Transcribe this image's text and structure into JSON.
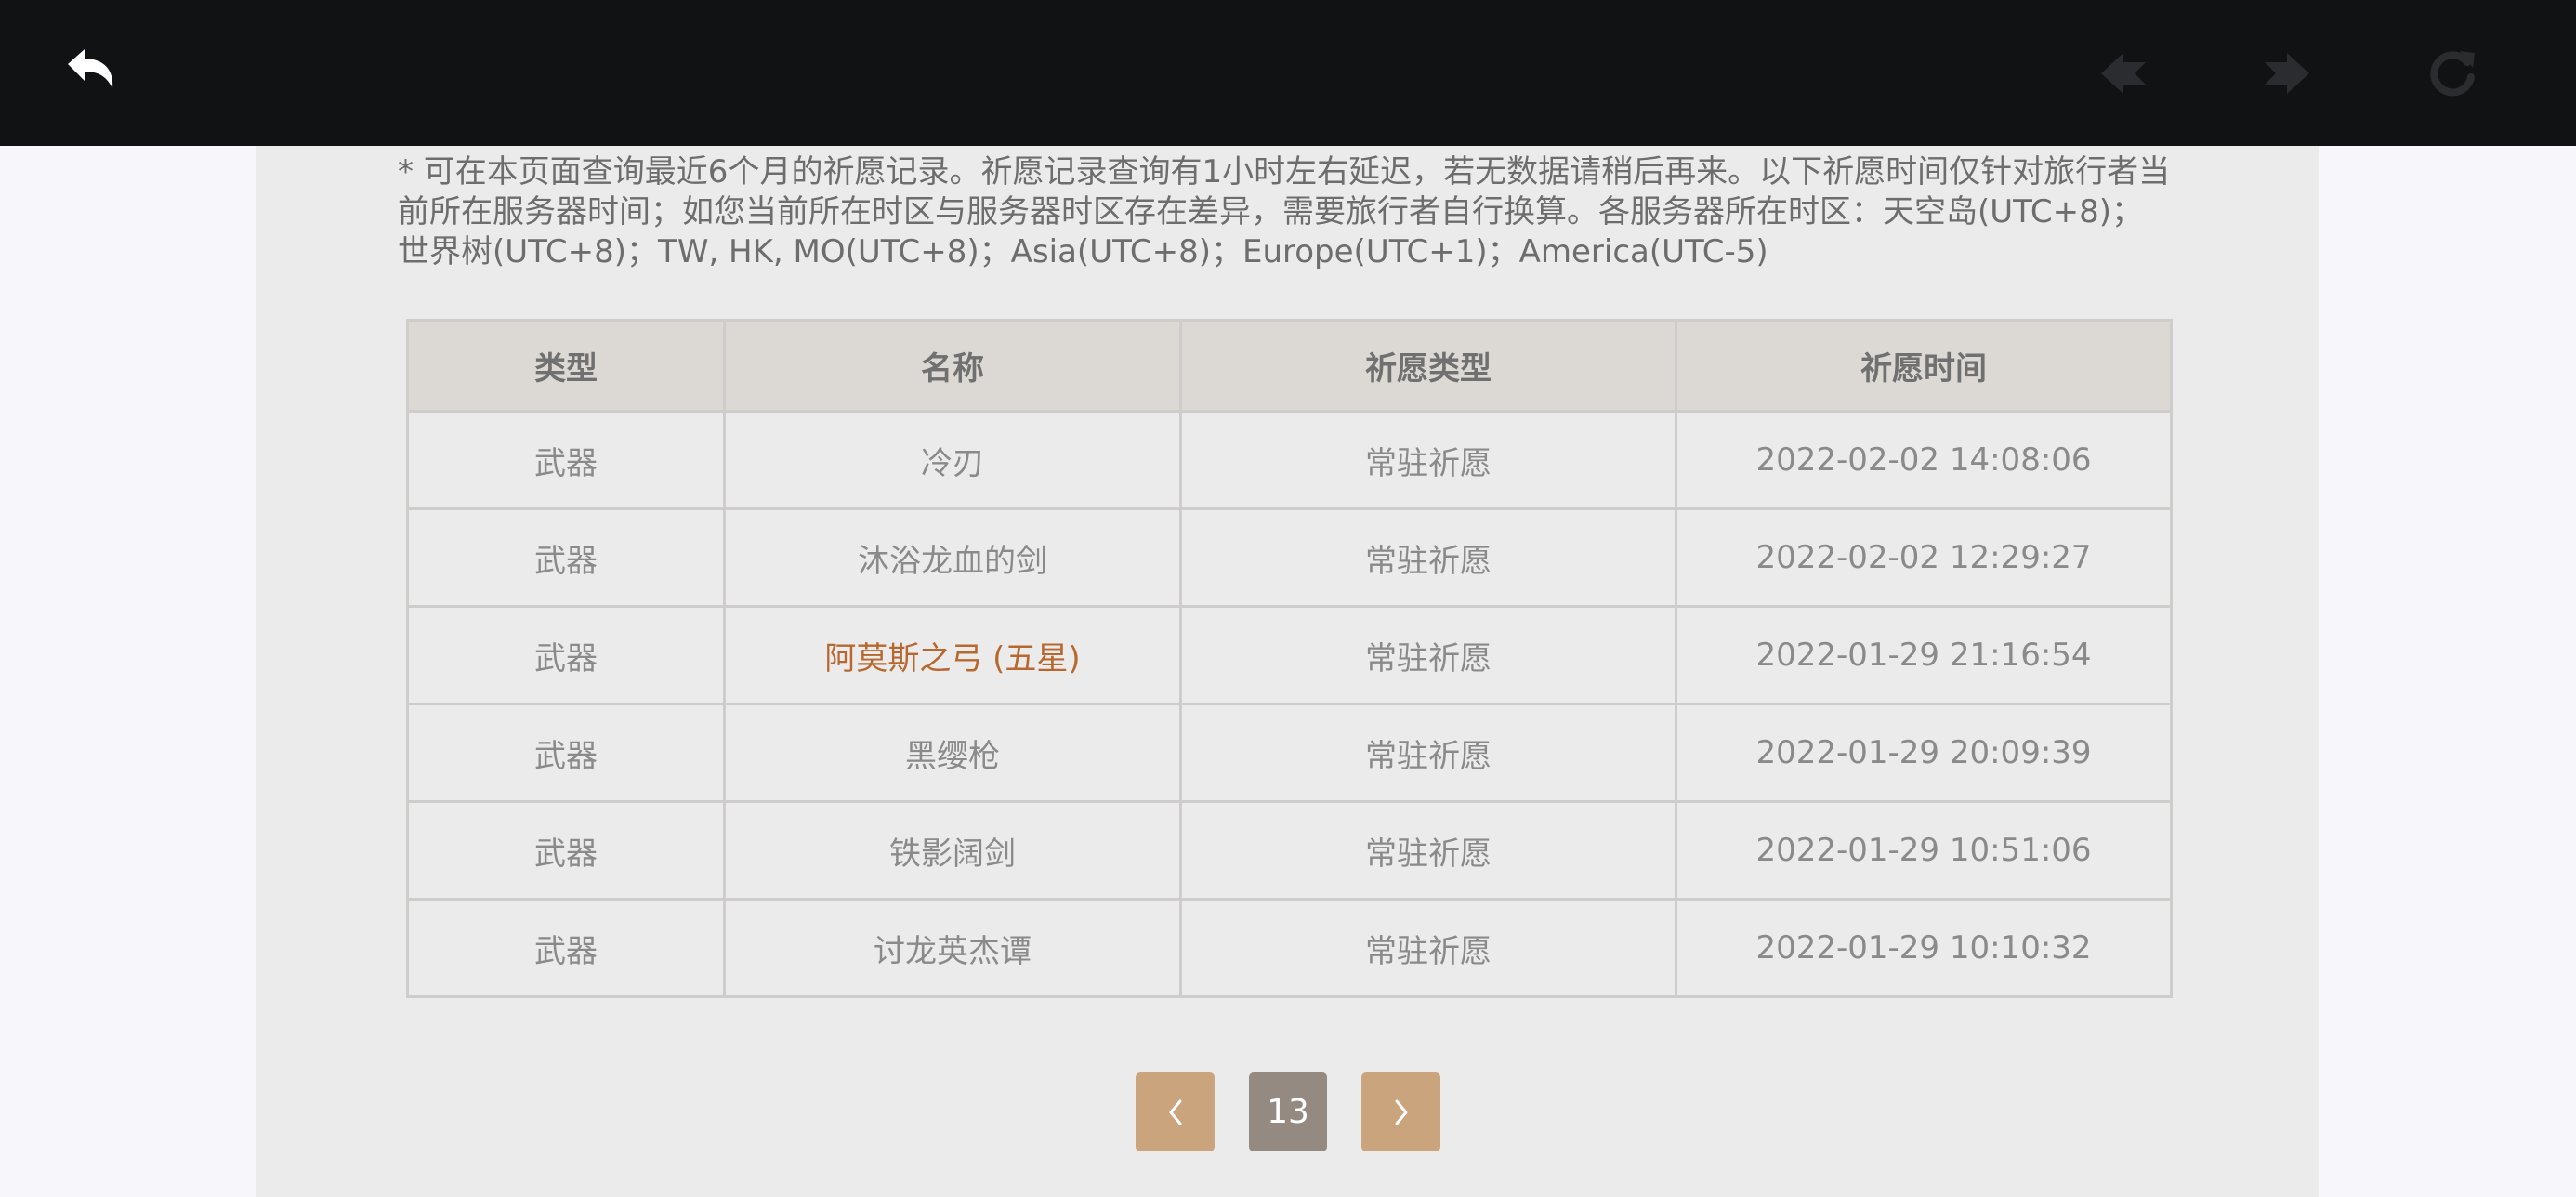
{
  "toolbar": {
    "back_icon": "back-arrow-icon",
    "prev_icon": "nav-prev-icon",
    "next_icon": "nav-next-icon",
    "reload_icon": "reload-icon"
  },
  "notice": {
    "text": "* 可在本页面查询最近6个月的祈愿记录。祈愿记录查询有1小时左右延迟，若无数据请稍后再来。以下祈愿时间仅针对旅行者当前所在服务器时间；如您当前所在时区与服务器时区存在差异，需要旅行者自行换算。各服务器所在时区：天空岛(UTC+8)；世界树(UTC+8)；TW, HK, MO(UTC+8)；Asia(UTC+8)；Europe(UTC+1)；America(UTC-5)"
  },
  "table": {
    "headers": [
      "类型",
      "名称",
      "祈愿类型",
      "祈愿时间"
    ],
    "rows": [
      {
        "type": "武器",
        "name": "冷刃",
        "wish_type": "常驻祈愿",
        "time": "2022-02-02 14:08:06"
      },
      {
        "type": "武器",
        "name": "沐浴龙血的剑",
        "wish_type": "常驻祈愿",
        "time": "2022-02-02 12:29:27"
      },
      {
        "type": "武器",
        "name": "阿莫斯之弓 (五星)",
        "wish_type": "常驻祈愿",
        "time": "2022-01-29 21:16:54"
      },
      {
        "type": "武器",
        "name": "黑缨枪",
        "wish_type": "常驻祈愿",
        "time": "2022-01-29 20:09:39"
      },
      {
        "type": "武器",
        "name": "铁影阔剑",
        "wish_type": "常驻祈愿",
        "time": "2022-01-29 10:51:06"
      },
      {
        "type": "武器",
        "name": "讨龙英杰谭",
        "wish_type": "常驻祈愿",
        "time": "2022-01-29 10:10:32"
      }
    ]
  },
  "pagination": {
    "current_page": "13",
    "prev_icon": "chevron-left-icon",
    "next_icon": "chevron-right-icon"
  },
  "colors": {
    "topbar": "#111214",
    "panel": "#ebebeb",
    "five_star": "#b8682f",
    "pager_button": "#c9a47c",
    "pager_current": "#948a82"
  }
}
